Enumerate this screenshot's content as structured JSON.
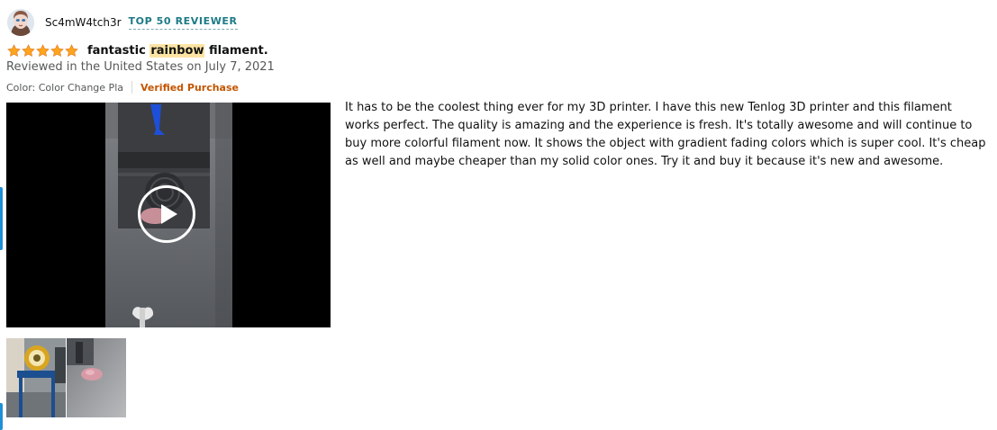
{
  "reviewer": {
    "name": "Sc4mW4tch3r",
    "badge": "TOP 50 REVIEWER",
    "avatar_icon": "reviewer-avatar"
  },
  "review": {
    "rating": 5,
    "rating_max": 5,
    "title_before": "fantastic ",
    "title_highlight": "rainbow",
    "title_after": " filament.",
    "date": "Reviewed in the United States on July 7, 2021",
    "variant": "Color: Color Change Pla",
    "verified": "Verified Purchase",
    "body": " It has to be the coolest thing ever for my 3D printer. I have this new Tenlog 3D printer and this filament works perfect. The quality is amazing and the experience is fresh. It's totally awesome and will continue to buy more colorful filament now. It shows the object with gradient fading colors which is super cool. It's cheap as well and maybe cheaper than my solid color ones. Try it and buy it because it's new and awesome."
  },
  "media": {
    "video_icon": "play-icon",
    "thumbnails": [
      "review-image-printer-spool",
      "review-image-print-bed"
    ]
  },
  "colors": {
    "star": "#ffa41c",
    "badge": "#1d7a86",
    "verified": "#c45500",
    "highlight": "#fde4a4",
    "accent": "#1f8fd8"
  }
}
